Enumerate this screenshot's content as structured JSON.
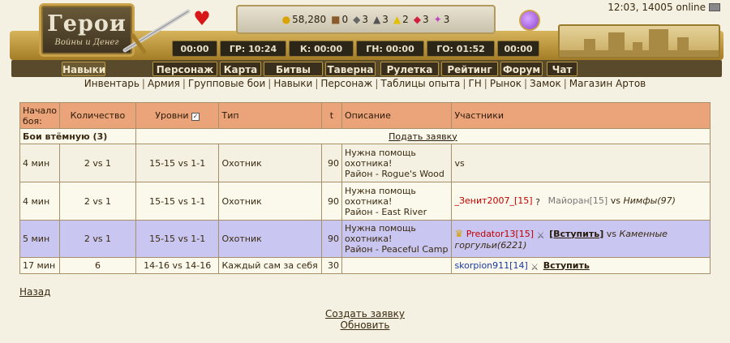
{
  "header": {
    "logo_title": "Герои",
    "logo_subtitle": "Войны и Денег",
    "clock": "12:03, 14005 online",
    "resources": [
      {
        "icon": "gold-icon",
        "value": "58,280"
      },
      {
        "icon": "wood-icon",
        "value": "0"
      },
      {
        "icon": "ore-icon",
        "value": "3"
      },
      {
        "icon": "mercury-icon",
        "value": "3"
      },
      {
        "icon": "sulfur-icon",
        "value": "2"
      },
      {
        "icon": "crystal-icon",
        "value": "3"
      },
      {
        "icon": "gems-icon",
        "value": "3"
      }
    ],
    "timers": [
      {
        "label": "00:00"
      },
      {
        "label": "ГР: 10:24"
      },
      {
        "label": "К: 00:00"
      },
      {
        "label": "ГН: 00:00"
      },
      {
        "label": "ГО: 01:52"
      },
      {
        "label": "00:00"
      }
    ],
    "nav": [
      {
        "label": "Навыки"
      },
      {
        "label": "Персонаж"
      },
      {
        "label": "Карта"
      },
      {
        "label": "Битвы"
      },
      {
        "label": "Таверна"
      },
      {
        "label": "Рулетка"
      },
      {
        "label": "Рейтинг"
      },
      {
        "label": "Форум"
      },
      {
        "label": "Чат"
      }
    ]
  },
  "submenu": [
    "Инвентарь",
    "Армия",
    "Групповые бои",
    "Навыки",
    "Персонаж",
    "Таблицы опыта",
    "ГН",
    "Рынок",
    "Замок",
    "Магазин Артов"
  ],
  "table": {
    "headers": {
      "start": "Начало боя:",
      "count": "Количество",
      "levels": "Уровни",
      "type": "Тип",
      "t": "t",
      "desc": "Описание",
      "participants": "Участники"
    },
    "group": {
      "label": "Бои втёмную (3)",
      "action": "Подать заявку"
    },
    "rows": [
      {
        "start": "4 мин",
        "count": "2 vs 1",
        "levels": "15-15 vs 1-1",
        "type": "Охотник",
        "t": "90",
        "desc1": "Нужна помощь охотника!",
        "desc2": "Район - Rogue's Wood",
        "participants": "vs"
      },
      {
        "start": "4 мин",
        "count": "2 vs 1",
        "levels": "15-15 vs 1-1",
        "type": "Охотник",
        "t": "90",
        "desc1": "Нужна помощь охотника!",
        "desc2": "Район - East River",
        "p1": "_Зенит2007_[15]",
        "p2": "Майоран[15]",
        "vs": "vs",
        "enemy": "Нимфы(97)"
      },
      {
        "start": "5 мин",
        "count": "2 vs 1",
        "levels": "15-15 vs 1-1",
        "type": "Охотник",
        "t": "90",
        "desc1": "Нужна помощь охотника!",
        "desc2": "Район - Peaceful Camp",
        "p1": "Predator13[15]",
        "join": "[Вступить]",
        "vs": "vs",
        "enemy": "Каменные горгульи(6221)"
      },
      {
        "start": "17 мин",
        "count": "6",
        "levels": "14-16 vs 14-16",
        "type": "Каждый сам за себя",
        "t": "30",
        "desc1": "",
        "desc2": "",
        "p1": "skorpion911[14]",
        "join": "Вступить"
      }
    ]
  },
  "footer": {
    "back": "Назад",
    "create": "Создать заявку",
    "refresh": "Обновить"
  }
}
